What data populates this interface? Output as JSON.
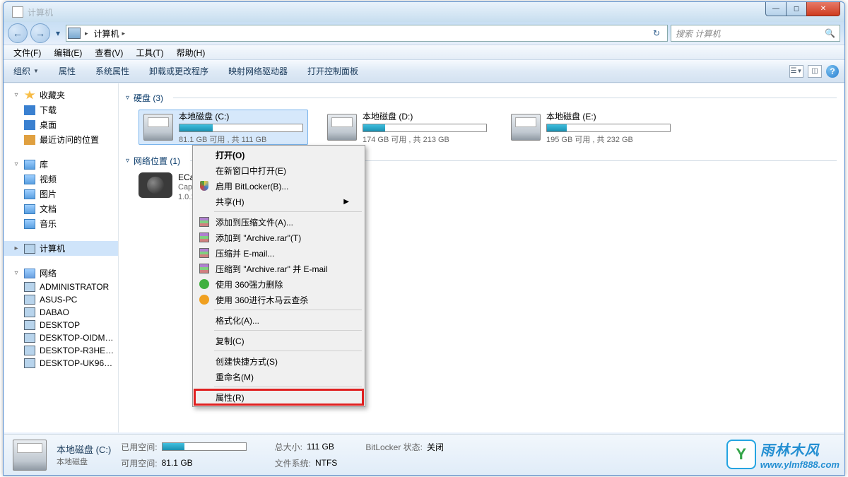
{
  "window": {
    "title": "计算机"
  },
  "nav": {
    "back": "←",
    "fwd": "→",
    "breadcrumb_root": "计算机",
    "search_placeholder": "搜索 计算机"
  },
  "menubar": [
    "文件(F)",
    "编辑(E)",
    "查看(V)",
    "工具(T)",
    "帮助(H)"
  ],
  "toolbar": {
    "organize": "组织",
    "items": [
      "属性",
      "系统属性",
      "卸载或更改程序",
      "映射网络驱动器",
      "打开控制面板"
    ]
  },
  "sidebar": {
    "favorites": {
      "label": "收藏夹",
      "items": [
        "下载",
        "桌面",
        "最近访问的位置"
      ]
    },
    "libraries": {
      "label": "库",
      "items": [
        "视频",
        "图片",
        "文档",
        "音乐"
      ]
    },
    "computer": {
      "label": "计算机"
    },
    "network": {
      "label": "网络",
      "items": [
        "ADMINISTRATOR",
        "ASUS-PC",
        "DABAO",
        "DESKTOP",
        "DESKTOP-OIDM…",
        "DESKTOP-R3HE…",
        "DESKTOP-UK96…"
      ]
    }
  },
  "sections": {
    "drives_header": "硬盘 (3)",
    "drives": [
      {
        "name": "本地磁盘 (C:)",
        "stat": "81.1 GB 可用 , 共 111 GB",
        "fill": 27,
        "selected": true
      },
      {
        "name": "本地磁盘 (D:)",
        "stat": "174 GB 可用 , 共 213 GB",
        "fill": 18,
        "selected": false
      },
      {
        "name": "本地磁盘 (E:)",
        "stat": "195 GB 可用 , 共 232 GB",
        "fill": 16,
        "selected": false
      }
    ],
    "netloc_header": "网络位置 (1)",
    "netloc": {
      "line1": "ECap…",
      "line2": "Capt…",
      "line3": "1.0.1…"
    }
  },
  "context_menu": {
    "items": [
      {
        "label": "打开(O)",
        "bold": true
      },
      {
        "label": "在新窗口中打开(E)"
      },
      {
        "label": "启用 BitLocker(B)...",
        "icon": "shield"
      },
      {
        "label": "共享(H)",
        "submenu": true
      },
      {
        "sep": true
      },
      {
        "label": "添加到压缩文件(A)...",
        "icon": "rar"
      },
      {
        "label": "添加到 \"Archive.rar\"(T)",
        "icon": "rar"
      },
      {
        "label": "压缩并 E-mail...",
        "icon": "rar"
      },
      {
        "label": "压缩到 \"Archive.rar\" 并 E-mail",
        "icon": "rar"
      },
      {
        "label": "使用 360强力删除",
        "icon": "360a"
      },
      {
        "label": "使用 360进行木马云查杀",
        "icon": "360b"
      },
      {
        "sep": true
      },
      {
        "label": "格式化(A)..."
      },
      {
        "sep": true
      },
      {
        "label": "复制(C)"
      },
      {
        "sep": true
      },
      {
        "label": "创建快捷方式(S)"
      },
      {
        "label": "重命名(M)"
      },
      {
        "sep": true
      },
      {
        "label": "属性(R)",
        "highlight": true
      }
    ]
  },
  "details": {
    "name": "本地磁盘 (C:)",
    "type": "本地磁盘",
    "used_label": "已用空间:",
    "used_fill": 27,
    "free_label": "可用空间:",
    "free_value": "81.1 GB",
    "total_label": "总大小:",
    "total_value": "111 GB",
    "fs_label": "文件系统:",
    "fs_value": "NTFS",
    "bitlocker_label": "BitLocker 状态:",
    "bitlocker_value": "关闭"
  },
  "watermark": {
    "title": "雨林木风",
    "url": "www.ylmf888.com"
  }
}
